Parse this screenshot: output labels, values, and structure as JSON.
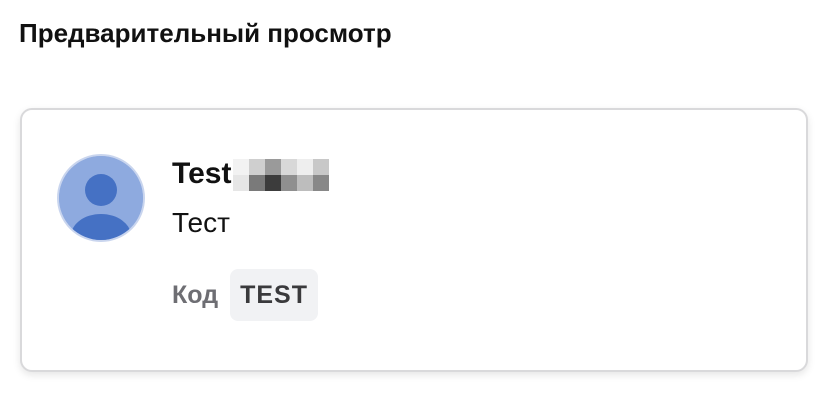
{
  "preview": {
    "title": "Предварительный просмотр"
  },
  "card": {
    "avatar_icon": "user-avatar-icon",
    "user_name": "Test",
    "user_name_redacted": true,
    "subtitle": "Тест",
    "code_label": "Код",
    "code_value": "TEST"
  },
  "colors": {
    "avatar_bg": "#8eaadf",
    "avatar_figure": "#4571c4",
    "card_border": "#d9d9db",
    "badge_bg": "#f1f2f4",
    "label_gray": "#6e6e73"
  }
}
